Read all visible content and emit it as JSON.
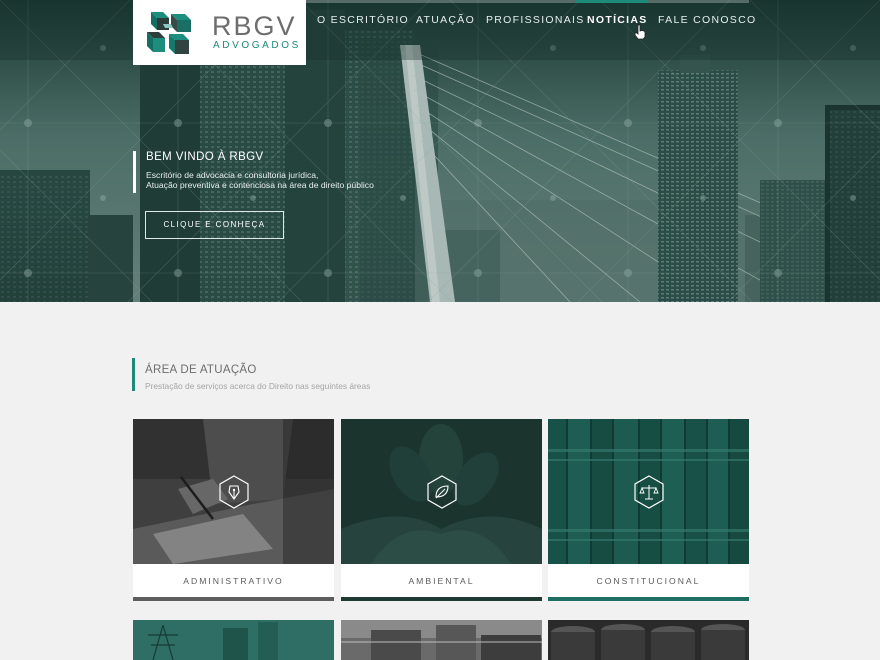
{
  "brand": {
    "name": "RBGV",
    "subtitle": "ADVOGADOS"
  },
  "nav": {
    "items": [
      {
        "label": "O ESCRITÓRIO",
        "active": false
      },
      {
        "label": "ATUAÇÃO",
        "active": false
      },
      {
        "label": "PROFISSIONAIS",
        "active": false
      },
      {
        "label": "NOTÍCIAS",
        "active": true
      },
      {
        "label": "FALE CONOSCO",
        "active": false
      }
    ]
  },
  "hero": {
    "title": "BEM VINDO À RBGV",
    "line1": "Escritório  de advocacia e consultoria jurídica,",
    "line2": "Atuação preventiva e contenciosa na área de direito público",
    "button": "CLIQUE E CONHEÇA"
  },
  "section": {
    "title": "ÁREA DE ATUAÇÃO",
    "subtitle": "Prestação de serviços acerca do Direito nas seguintes áreas"
  },
  "cards": [
    {
      "label": "ADMINISTRATIVO",
      "icon": "fountain-pen-icon",
      "bar_color": "#5e5e5e"
    },
    {
      "label": "AMBIENTAL",
      "icon": "leaf-icon",
      "bar_color": "#1f3a33"
    },
    {
      "label": "CONSTITUCIONAL",
      "icon": "scales-icon",
      "bar_color": "#1e6e64"
    }
  ],
  "colors": {
    "accent": "#1e8a7a",
    "hero_dark": "#1f3a36",
    "background": "#f1f1f1"
  }
}
